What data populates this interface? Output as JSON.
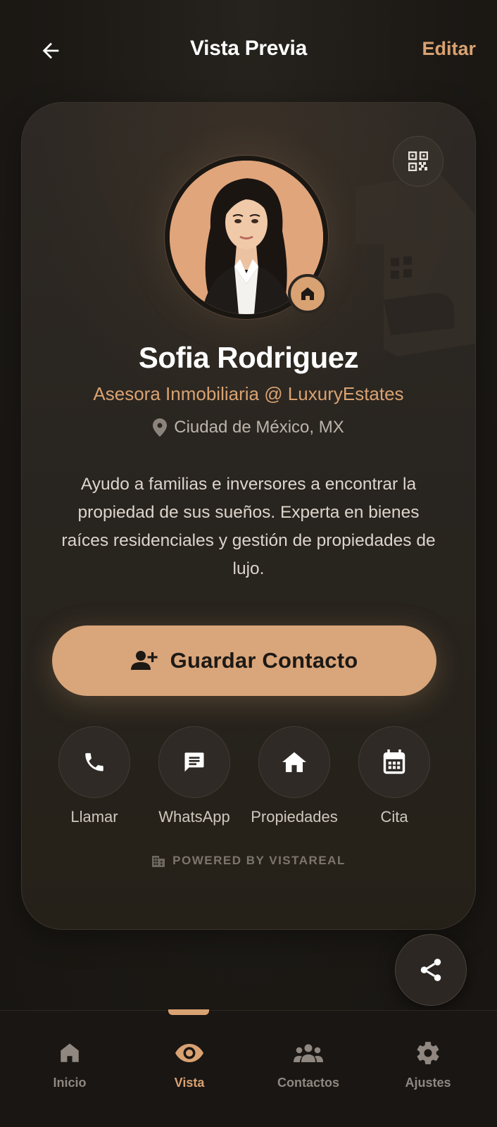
{
  "header": {
    "title": "Vista Previa",
    "edit_label": "Editar"
  },
  "profile": {
    "name": "Sofia Rodriguez",
    "role": "Asesora Inmobiliaria @ LuxuryEstates",
    "location": "Ciudad de México, MX",
    "bio": "Ayudo a familias e inversores a encontrar la propiedad de sus sueños. Experta en bienes raíces residenciales y gestión de propiedades de lujo."
  },
  "save_button": {
    "label": "Guardar Contacto",
    "icon": "person-add-icon"
  },
  "actions": [
    {
      "label": "Llamar",
      "icon": "phone-icon"
    },
    {
      "label": "WhatsApp",
      "icon": "chat-icon"
    },
    {
      "label": "Propiedades",
      "icon": "home-icon"
    },
    {
      "label": "Cita",
      "icon": "calendar-icon"
    }
  ],
  "footer": {
    "powered_by": "POWERED BY VISTAREAL"
  },
  "nav": {
    "items": [
      {
        "label": "Inicio",
        "icon": "home-icon",
        "active": false
      },
      {
        "label": "Vista",
        "icon": "eye-icon",
        "active": true
      },
      {
        "label": "Contactos",
        "icon": "group-icon",
        "active": false
      },
      {
        "label": "Ajustes",
        "icon": "gear-icon",
        "active": false
      }
    ]
  },
  "colors": {
    "accent": "#d9a272",
    "background": "#1c1915",
    "card": "#2b2621"
  }
}
